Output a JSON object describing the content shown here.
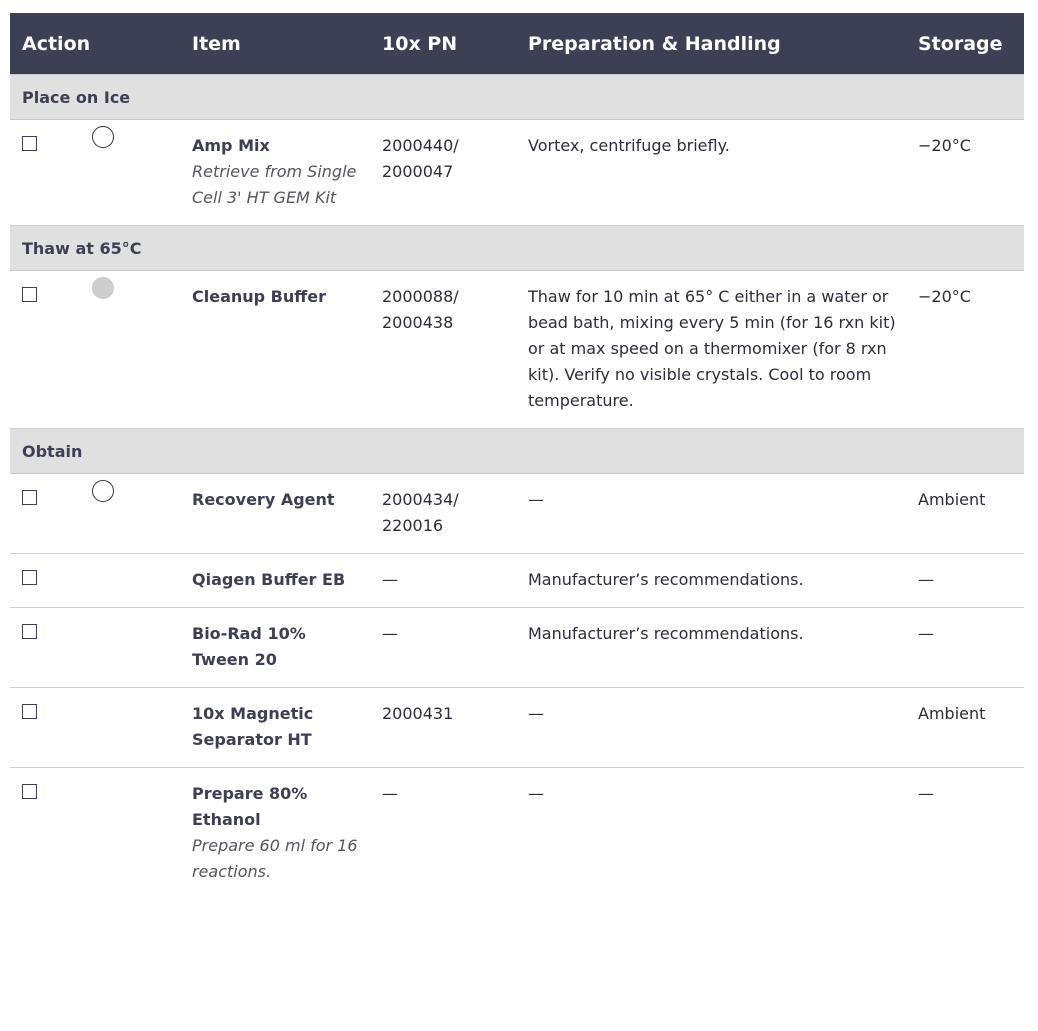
{
  "headers": {
    "action": "Action",
    "item": "Item",
    "pn": "10x PN",
    "prep": "Preparation & Handling",
    "storage": "Storage"
  },
  "sections": {
    "ice": "Place on Ice",
    "thaw": "Thaw at 65°C",
    "obtain": "Obtain"
  },
  "rows": [
    {
      "circle": "outline",
      "name": "Amp Mix",
      "note": "Retrieve from Single Cell 3' HT GEM Kit",
      "pn": "2000440/ 2000047",
      "prep": "Vortex, centrifuge briefly.",
      "storage": "−20°C"
    },
    {
      "circle": "filled",
      "name": "Cleanup Buffer",
      "note": "",
      "pn": "2000088/ 2000438",
      "prep": "Thaw for 10 min at 65° C either in a water or bead bath, mixing every 5 min (for 16 rxn kit) or at max speed on a thermomixer (for 8 rxn kit). Verify no visible crystals. Cool to room temperature.",
      "storage": "−20°C"
    },
    {
      "circle": "outline",
      "name": "Recovery Agent",
      "note": "",
      "pn": "2000434/ 220016",
      "prep": "—",
      "storage": "Ambient"
    },
    {
      "circle": "none",
      "name": "Qiagen Buffer EB",
      "note": "",
      "pn": "—",
      "prep": "Manufacturer’s recommendations.",
      "storage": "—"
    },
    {
      "circle": "none",
      "name": "Bio-Rad 10% Tween 20",
      "note": "",
      "pn": "—",
      "prep": "Manufacturer’s recommendations.",
      "storage": "—"
    },
    {
      "circle": "none",
      "name": "10x Magnetic Separator HT",
      "note": "",
      "pn": "2000431",
      "prep": "—",
      "storage": "Ambient"
    },
    {
      "circle": "none",
      "name": "Prepare 80% Ethanol",
      "note": "Prepare 60 ml for 16 reactions.",
      "pn": "—",
      "prep": "—",
      "storage": "—"
    }
  ]
}
